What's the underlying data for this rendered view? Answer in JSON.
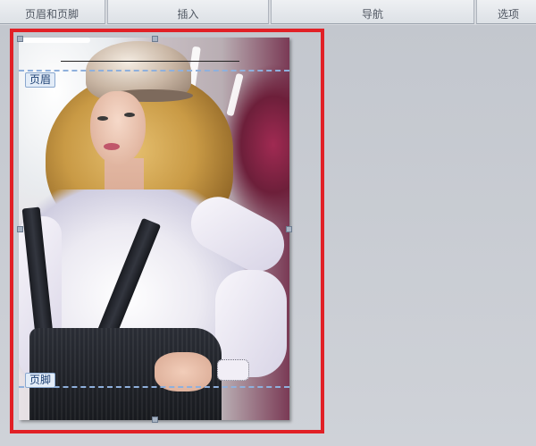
{
  "ribbon": {
    "groups": [
      {
        "label": "页眉和页脚"
      },
      {
        "label": "插入"
      },
      {
        "label": "导航"
      },
      {
        "label": "选项"
      }
    ]
  },
  "document": {
    "header_tag": "页眉",
    "footer_tag": "页脚"
  },
  "colors": {
    "highlight": "#e12026",
    "guide_dash": "#8fb0dc",
    "workspace": "#c9ccd2"
  }
}
